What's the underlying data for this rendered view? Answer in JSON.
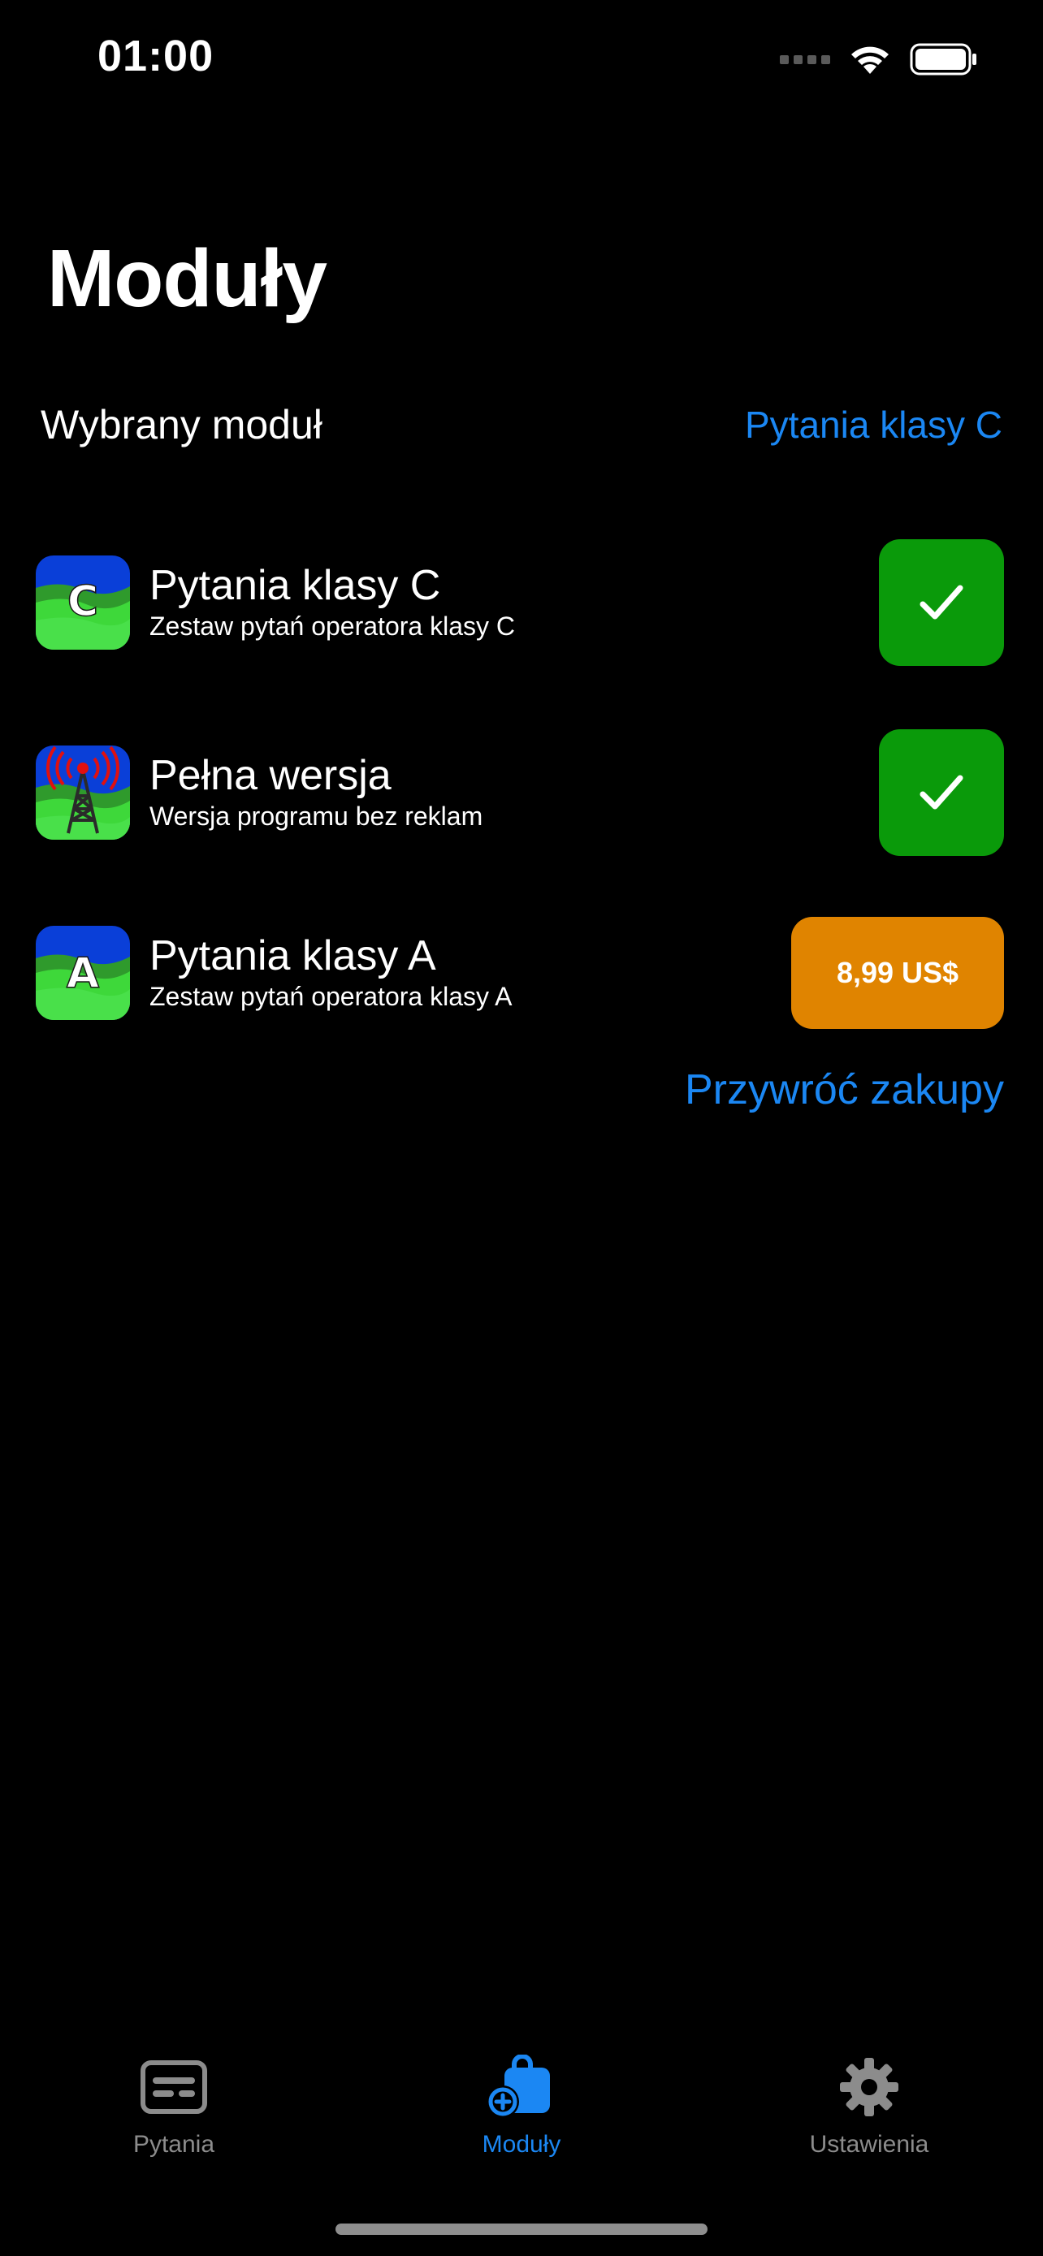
{
  "status_bar": {
    "time": "01:00",
    "icons": [
      "cellular-signal-icon",
      "wifi-icon",
      "battery-icon"
    ]
  },
  "header": {
    "title": "Moduły"
  },
  "selected_module": {
    "label": "Wybrany moduł",
    "value": "Pytania klasy C"
  },
  "modules": [
    {
      "name": "Pytania klasy C",
      "description": "Zestaw pytań operatora klasy C",
      "icon_letter": "C",
      "status": "owned",
      "action_icon": "checkmark-icon"
    },
    {
      "name": "Pełna wersja",
      "description": "Wersja programu bez reklam",
      "icon": "radio-tower-icon",
      "status": "owned",
      "action_icon": "checkmark-icon"
    },
    {
      "name": "Pytania klasy A",
      "description": "Zestaw pytań operatora klasy A",
      "icon_letter": "A",
      "status": "for-sale",
      "price": "8,99 US$"
    }
  ],
  "restore_purchases": "Przywróć zakupy",
  "tab_bar": {
    "tabs": [
      {
        "label": "Pytania",
        "icon": "card-icon",
        "active": false
      },
      {
        "label": "Moduły",
        "icon": "shopping-bag-add-icon",
        "active": true
      },
      {
        "label": "Ustawienia",
        "icon": "gear-icon",
        "active": false
      }
    ]
  },
  "colors": {
    "background": "#000000",
    "accent": "#1b87f3",
    "owned_green": "#0a9a0a",
    "price_orange": "#e08400",
    "tab_inactive": "#8c8c8c"
  }
}
